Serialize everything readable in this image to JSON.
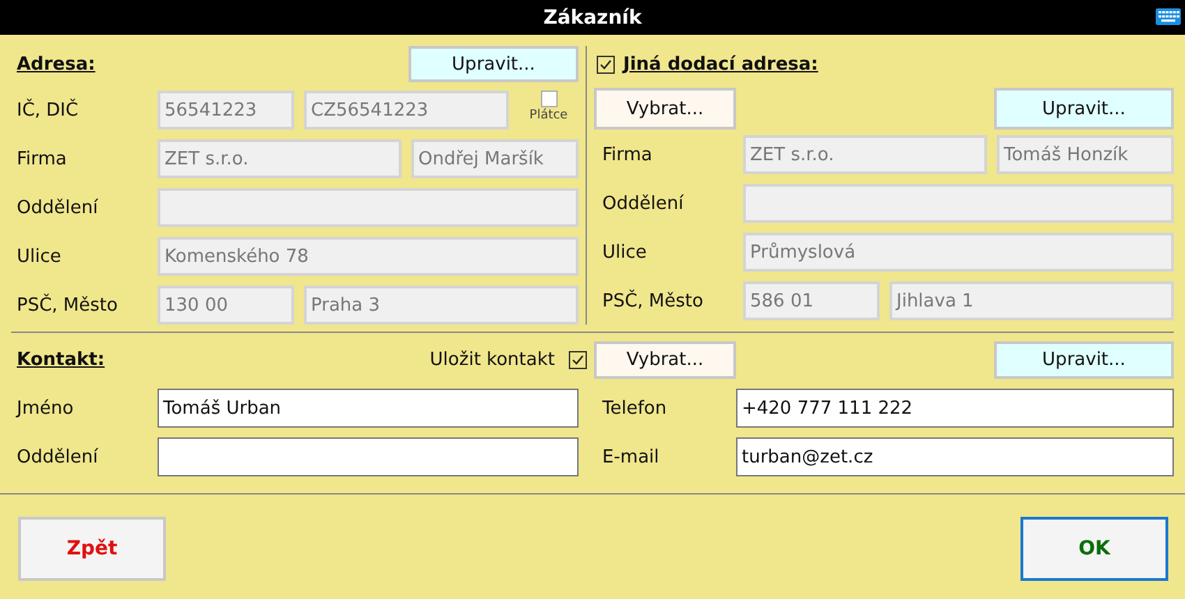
{
  "window": {
    "title": "Zákazník"
  },
  "address": {
    "heading": "Adresa:",
    "edit_button": "Upravit...",
    "rows": [
      {
        "label": "IČ, DIČ",
        "kind": "ico",
        "fields": [
          {
            "value": "56541223",
            "disabled": true
          },
          {
            "value": "CZ56541223",
            "disabled": true
          }
        ],
        "checkbox": {
          "label": "Plátce",
          "checked": false
        }
      },
      {
        "label": "Firma",
        "kind": "pair",
        "fields": [
          {
            "value": "ZET s.r.o.",
            "disabled": true
          },
          {
            "value": "Ondřej Maršík",
            "disabled": true
          }
        ]
      },
      {
        "label": "Oddělení",
        "kind": "single",
        "fields": [
          {
            "disabled": true
          }
        ]
      },
      {
        "label": "Ulice",
        "kind": "single",
        "fields": [
          {
            "value": "Komenského 78",
            "disabled": true
          }
        ]
      },
      {
        "label": "PSČ, Město",
        "kind": "city",
        "fields": [
          {
            "value": "130 00",
            "disabled": true
          },
          {
            "value": "Praha 3",
            "disabled": true
          }
        ]
      }
    ]
  },
  "delivery": {
    "checked": true,
    "heading": "Jiná dodací adresa:",
    "select_button": "Vybrat...",
    "edit_button": "Upravit...",
    "rows": [
      {
        "label": "Firma",
        "kind": "pair",
        "fields": [
          {
            "value": "ZET s.r.o.",
            "disabled": true
          },
          {
            "value": "Tomáš Honzík",
            "disabled": true
          }
        ]
      },
      {
        "label": "Oddělení",
        "kind": "single",
        "fields": [
          {
            "disabled": true
          }
        ]
      },
      {
        "label": "Ulice",
        "kind": "single",
        "fields": [
          {
            "value": "Průmyslová",
            "disabled": true
          }
        ]
      },
      {
        "label": "PSČ, Město",
        "kind": "city",
        "fields": [
          {
            "value": "586 01",
            "disabled": true
          },
          {
            "value": "Jihlava 1",
            "disabled": true
          }
        ]
      }
    ]
  },
  "contact": {
    "heading": "Kontakt:",
    "save_label": "Uložit kontakt",
    "save_checked": true,
    "select_button": "Vybrat...",
    "edit_button": "Upravit...",
    "rows": [
      {
        "label": "Jméno",
        "value": "Tomáš Urban"
      },
      {
        "label": "Telefon",
        "value": "+420 777 111 222"
      },
      {
        "label": "Oddělení"
      },
      {
        "label": "E-mail",
        "value": "turban@zet.cz"
      }
    ]
  },
  "buttons": [
    {
      "label": "Zpět",
      "kind": "back"
    },
    {
      "label": "OK",
      "kind": "ok"
    }
  ]
}
